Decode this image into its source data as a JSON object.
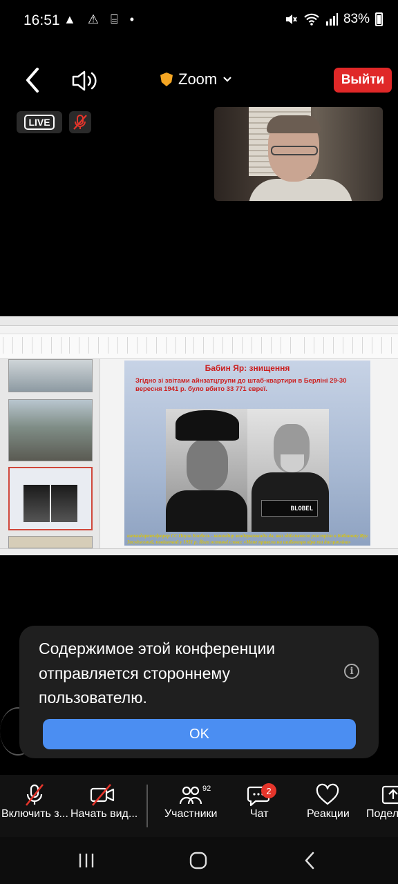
{
  "status_bar": {
    "time": "16:51",
    "left_icons": "▲ ⚠ ⌸ •",
    "battery": "83%"
  },
  "top_bar": {
    "app_title": "Zoom",
    "leave_label": "Выйти"
  },
  "live_label": "LIVE",
  "slide": {
    "title": "Бабин Яр: знищення",
    "text": "Згідно зі звітами айнзатцгрупи до штаб-квартири в Берліні 29-30 вересня 1941 р. було вбито 33 771 євреї.",
    "sign": "BLOBEL",
    "footer": "штандартенфюрер СС Пауль Блобель - командир зондеркоманди 4а, яка здійснювала розстріли в Бабиному Яру. Засуджений, повішений у 1951 р. Його останні слова: «Мене привели на шибеницю віра та дисципліна»"
  },
  "notice": {
    "message": "Содержимое этой конференции отправляется стороннему пользователю.",
    "ok_label": "OK"
  },
  "toolbar": {
    "mute_label": "Включить з...",
    "video_label": "Начать вид...",
    "participants_label": "Участники",
    "participants_count": "92",
    "chat_label": "Чат",
    "chat_count": "2",
    "reactions_label": "Реакции",
    "share_label": "Подел"
  },
  "colors": {
    "leave_red": "#e02828",
    "ok_blue": "#4b8ef2",
    "chat_badge_red": "#e5352b"
  }
}
